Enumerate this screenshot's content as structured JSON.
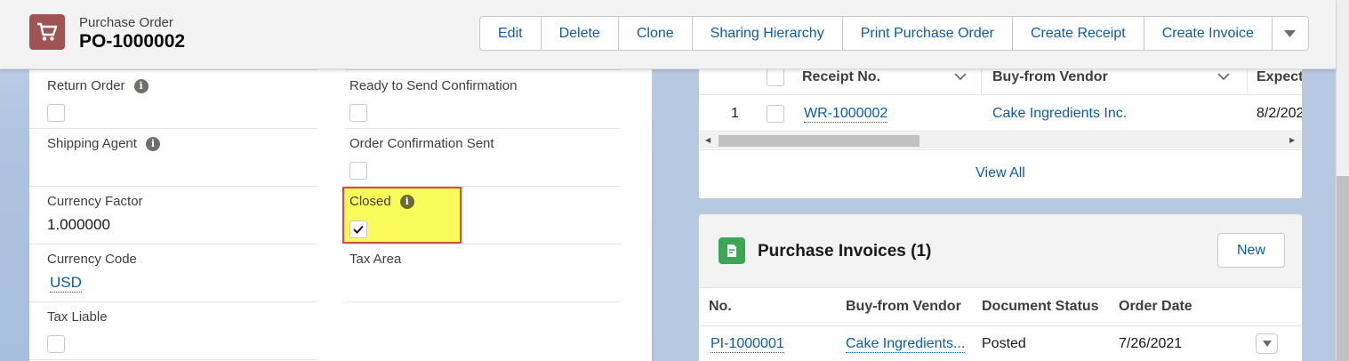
{
  "header": {
    "object_type": "Purchase Order",
    "record_name": "PO-1000002",
    "icon": "cart-icon",
    "icon_bg": "#a05352",
    "actions": [
      {
        "id": "edit",
        "label": "Edit"
      },
      {
        "id": "delete",
        "label": "Delete"
      },
      {
        "id": "clone",
        "label": "Clone"
      },
      {
        "id": "sharing-hierarchy",
        "label": "Sharing Hierarchy"
      },
      {
        "id": "print-purchase-order",
        "label": "Print Purchase Order"
      },
      {
        "id": "create-receipt",
        "label": "Create Receipt"
      },
      {
        "id": "create-invoice",
        "label": "Create Invoice"
      }
    ]
  },
  "details": {
    "return_order": {
      "label": "Return Order",
      "checked": false
    },
    "ready_to_send": {
      "label": "Ready to Send Confirmation",
      "checked": false
    },
    "shipping_agent": {
      "label": "Shipping Agent",
      "value": ""
    },
    "order_confirmation_sent": {
      "label": "Order Confirmation Sent",
      "checked": false
    },
    "currency_factor": {
      "label": "Currency Factor",
      "value": "1.000000"
    },
    "closed": {
      "label": "Closed",
      "checked": true
    },
    "currency_code": {
      "label": "Currency Code",
      "value": "USD"
    },
    "tax_area": {
      "label": "Tax Area",
      "value": ""
    },
    "tax_liable": {
      "label": "Tax Liable",
      "checked": false
    }
  },
  "receipts": {
    "columns": [
      "Receipt No.",
      "Buy-from Vendor",
      "Expecte"
    ],
    "rows": [
      {
        "row_num": "1",
        "receipt_no": "WR-1000002",
        "vendor": "Cake Ingredients Inc.",
        "expected": "8/2/202"
      }
    ],
    "view_all": "View All"
  },
  "invoices": {
    "title": "Purchase Invoices (1)",
    "new_label": "New",
    "icon_bg": "#3ba755",
    "columns": [
      "No.",
      "Buy-from Vendor",
      "Document Status",
      "Order Date"
    ],
    "rows": [
      {
        "no": "PI-1000001",
        "vendor": "Cake Ingredients...",
        "status": "Posted",
        "order_date": "7/26/2021"
      }
    ]
  },
  "colors": {
    "link": "#0b5cab",
    "highlight_fill": "#fafb5b",
    "highlight_border": "#d94b3a"
  }
}
